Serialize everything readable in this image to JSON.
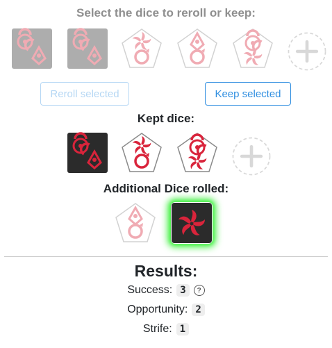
{
  "headings": {
    "select": "Select the dice to reroll or keep:",
    "kept": "Kept dice:",
    "additional": "Additional Dice rolled:"
  },
  "buttons": {
    "reroll": "Reroll selected",
    "keep": "Keep selected"
  },
  "results": {
    "title": "Results:",
    "success_label": "Success:",
    "success_value": "3",
    "opportunity_label": "Opportunity:",
    "opportunity_value": "2",
    "strife_label": "Strife:",
    "strife_value": "1"
  },
  "colors": {
    "symbol_red": "#d9243b",
    "dark_die": "#2b2b2b",
    "glow": "#4df04d",
    "button_blue": "#2f8ee0"
  }
}
